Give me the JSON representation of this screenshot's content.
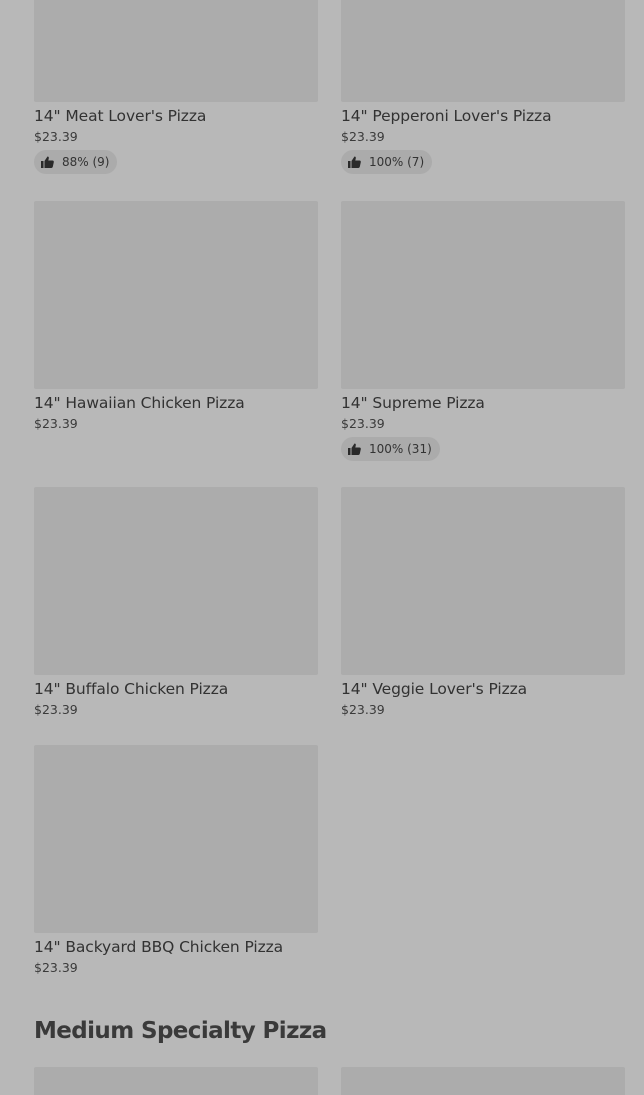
{
  "menu": {
    "items": [
      {
        "title": "14\" Meat Lover's Pizza",
        "price": "$23.39",
        "rating": "88% (9)"
      },
      {
        "title": "14\" Pepperoni Lover's Pizza",
        "price": "$23.39",
        "rating": "100% (7)"
      },
      {
        "title": "14\" Hawaiian Chicken Pizza",
        "price": "$23.39"
      },
      {
        "title": "14\" Supreme Pizza",
        "price": "$23.39",
        "rating": "100% (31)"
      },
      {
        "title": "14\" Buffalo Chicken Pizza",
        "price": "$23.39"
      },
      {
        "title": "14\" Veggie Lover's Pizza",
        "price": "$23.39"
      },
      {
        "title": "14\" Backyard BBQ Chicken Pizza",
        "price": "$23.39"
      }
    ]
  },
  "next_section": {
    "title": "Medium Specialty Pizza"
  },
  "icons": {
    "rating": "thumbs-up-icon"
  },
  "colors": {
    "background": "#b8b8b8",
    "image_placeholder": "#acacac",
    "rating_pill": "#ababab",
    "text": "#323232"
  }
}
